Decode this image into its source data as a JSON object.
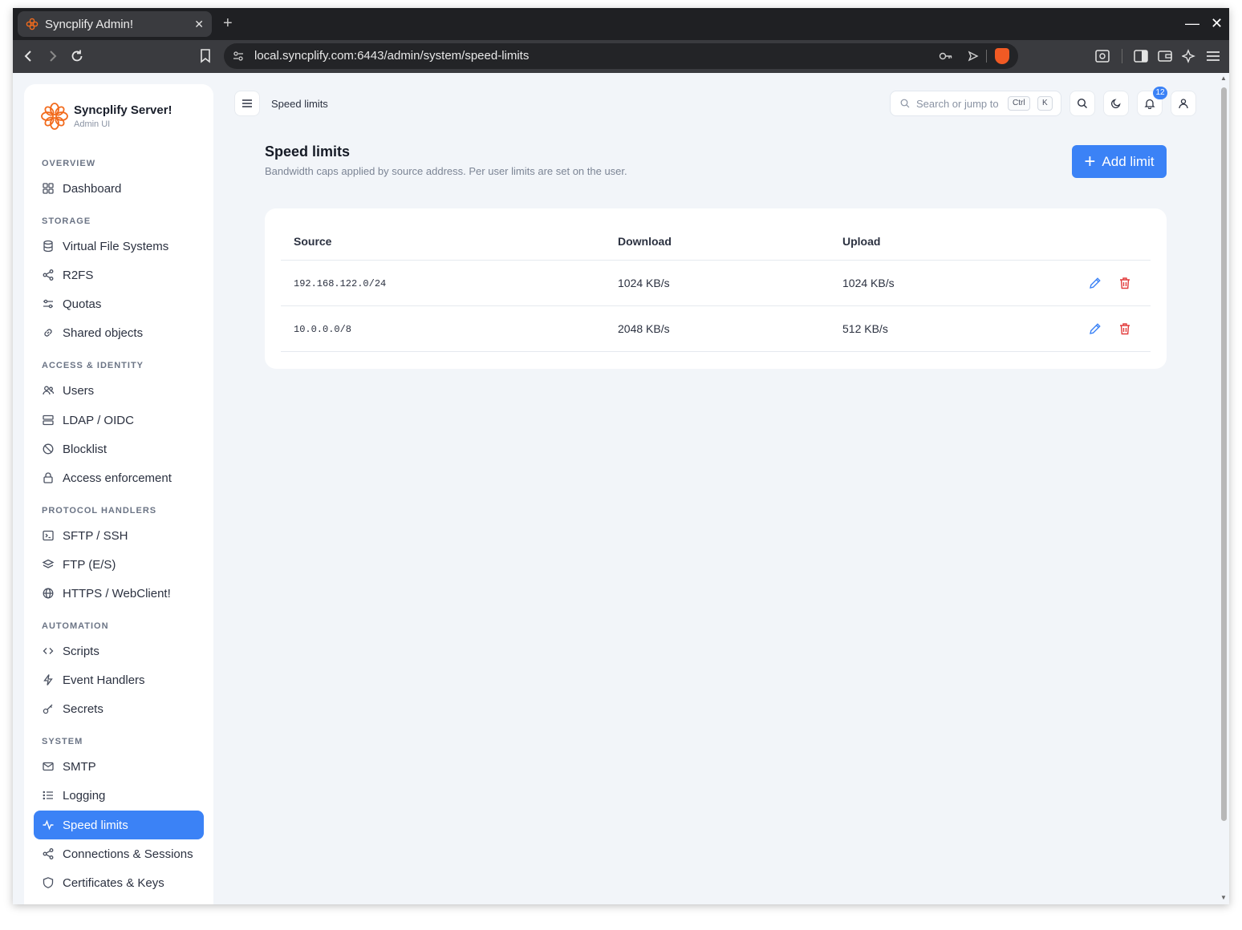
{
  "browser": {
    "tab_title": "Syncplify Admin!",
    "url": "local.syncplify.com:6443/admin/system/speed-limits"
  },
  "sidebar": {
    "brand_name": "Syncplify Server!",
    "brand_sub": "Admin UI",
    "sections": {
      "overview": "OVERVIEW",
      "storage": "STORAGE",
      "access": "ACCESS & IDENTITY",
      "protocol": "PROTOCOL HANDLERS",
      "automation": "AUTOMATION",
      "system": "SYSTEM"
    },
    "items": {
      "dashboard": "Dashboard",
      "vfs": "Virtual File Systems",
      "r2fs": "R2FS",
      "quotas": "Quotas",
      "shared": "Shared objects",
      "users": "Users",
      "ldap": "LDAP / OIDC",
      "blocklist": "Blocklist",
      "access_enf": "Access enforcement",
      "sftp": "SFTP / SSH",
      "ftp": "FTP (E/S)",
      "https": "HTTPS / WebClient!",
      "scripts": "Scripts",
      "events": "Event Handlers",
      "secrets": "Secrets",
      "smtp": "SMTP",
      "logging": "Logging",
      "speed": "Speed limits",
      "connections": "Connections & Sessions",
      "certs": "Certificates & Keys"
    }
  },
  "header": {
    "breadcrumb": "Speed limits",
    "search_placeholder": "Search or jump to",
    "kbd_ctrl": "Ctrl",
    "kbd_k": "K",
    "notif_count": "12"
  },
  "main": {
    "title": "Speed limits",
    "description": "Bandwidth caps applied by source address. Per user limits are set on the user.",
    "add_label": "Add limit",
    "add_plus": "+",
    "table": {
      "col_source": "Source",
      "col_download": "Download",
      "col_upload": "Upload",
      "rows": [
        {
          "source": "192.168.122.0/24",
          "download": "1024 KB/s",
          "upload": "1024 KB/s"
        },
        {
          "source": "10.0.0.0/8",
          "download": "2048 KB/s",
          "upload": "512 KB/s"
        }
      ]
    }
  },
  "colors": {
    "accent": "#3b82f6",
    "danger": "#e23b3b",
    "brand": "#f26b1d"
  }
}
